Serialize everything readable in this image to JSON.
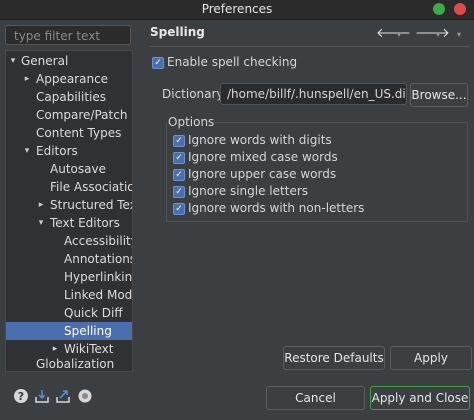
{
  "window": {
    "title": "Preferences"
  },
  "filter": {
    "placeholder": "type filter text"
  },
  "tree": {
    "items": [
      {
        "label": "General",
        "twisty": "▾"
      },
      {
        "label": "Appearance",
        "twisty": "▸"
      },
      {
        "label": "Capabilities",
        "twisty": ""
      },
      {
        "label": "Compare/Patch",
        "twisty": ""
      },
      {
        "label": "Content Types",
        "twisty": ""
      },
      {
        "label": "Editors",
        "twisty": "▾"
      },
      {
        "label": "Autosave",
        "twisty": ""
      },
      {
        "label": "File Associations",
        "twisty": ""
      },
      {
        "label": "Structured Text E",
        "twisty": "▸"
      },
      {
        "label": "Text Editors",
        "twisty": "▾"
      },
      {
        "label": "Accessibility",
        "twisty": ""
      },
      {
        "label": "Annotations",
        "twisty": ""
      },
      {
        "label": "Hyperlinking",
        "twisty": ""
      },
      {
        "label": "Linked Mode",
        "twisty": ""
      },
      {
        "label": "Quick Diff",
        "twisty": ""
      },
      {
        "label": "Spelling",
        "twisty": ""
      },
      {
        "label": "WikiText",
        "twisty": "▸"
      },
      {
        "label": "Globalization",
        "twisty": ""
      }
    ],
    "selected_label": "Spelling"
  },
  "page": {
    "title": "Spelling",
    "nav": {
      "back": "🡐",
      "forward": "🡒",
      "dropdown": "▾"
    },
    "enable_spell": {
      "label": "Enable spell checking",
      "checked": true
    },
    "dictionary": {
      "label": "Dictionary",
      "value": "/home/billf/.hunspell/en_US.dic",
      "browse": "Browse..."
    },
    "options": {
      "title": "Options",
      "items": [
        {
          "label": "Ignore words with digits",
          "checked": true
        },
        {
          "label": "Ignore mixed case words",
          "checked": true
        },
        {
          "label": "Ignore upper case words",
          "checked": true
        },
        {
          "label": "Ignore single letters",
          "checked": true
        },
        {
          "label": "Ignore words with non-letters",
          "checked": true
        }
      ]
    },
    "restore_defaults": "Restore Defaults",
    "apply": "Apply"
  },
  "footer": {
    "icons": [
      "help-icon",
      "import-icon",
      "export-icon",
      "record-icon"
    ],
    "cancel": "Cancel",
    "apply_and_close": "Apply and Close"
  },
  "colors": {
    "accent": "#4b6eaf",
    "default_button_border": "#3fa04a"
  }
}
